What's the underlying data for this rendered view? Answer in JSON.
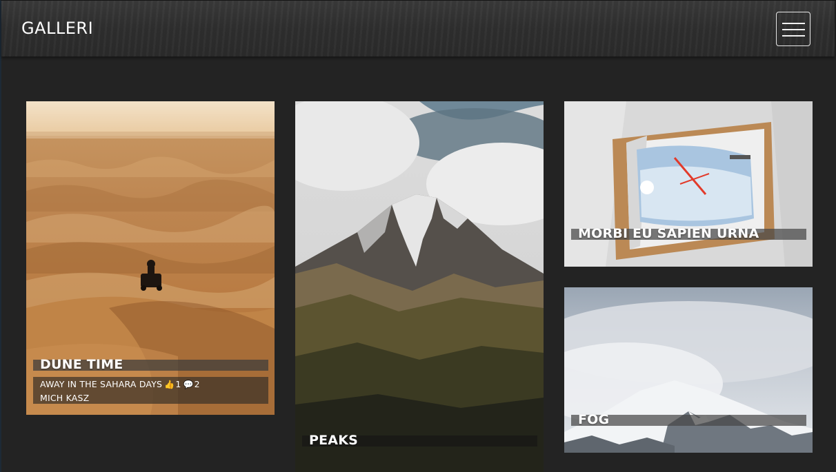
{
  "header": {
    "brand": "GALLERI",
    "menu_icon": "hamburger-menu-icon"
  },
  "cards": [
    {
      "title": "DUNE TIME",
      "subtitle": "AWAY IN THE SAHARA DAYS",
      "likes": "1",
      "comments": "2",
      "author": "MICH KASZ",
      "like_icon": "thumbs-up-icon",
      "comment_icon": "comment-icon"
    },
    {
      "title": "PEAKS"
    },
    {
      "title": "MORBI EU SAPIEN URNA"
    },
    {
      "title": "FOG"
    }
  ],
  "colors": {
    "page_bg": "#232323",
    "header_bg": "#2f2f2f",
    "title_bar": "rgba(60,60,60,0.72)"
  }
}
